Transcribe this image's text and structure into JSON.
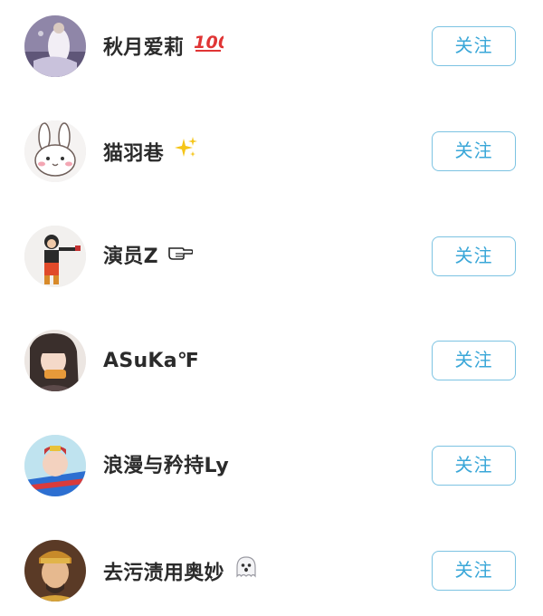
{
  "users": [
    {
      "name": "秋月爱莉",
      "emoji": "hundred-points-icon",
      "follow_label": "关注"
    },
    {
      "name": "猫羽巷",
      "emoji": "sparkles-icon",
      "follow_label": "关注"
    },
    {
      "name": "演员Z",
      "emoji": "pointing-hand-icon",
      "follow_label": "关注"
    },
    {
      "name": "ASuKa℉",
      "emoji": "",
      "follow_label": "关注"
    },
    {
      "name": "浪漫与矜持Ly",
      "emoji": "",
      "follow_label": "关注"
    },
    {
      "name": "去污渍用奥妙",
      "emoji": "ghost-icon",
      "follow_label": "关注"
    }
  ],
  "colors": {
    "button_border": "#7cc3e2",
    "button_text": "#3aa7d8",
    "name_text": "#2b2b2b"
  }
}
